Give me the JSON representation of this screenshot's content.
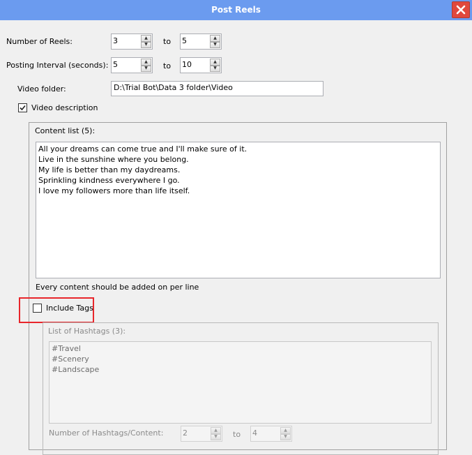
{
  "window": {
    "title": "Post Reels"
  },
  "reels": {
    "label": "Number of Reels:",
    "from": "3",
    "to_label": "to",
    "to": "5"
  },
  "interval": {
    "label": "Posting Interval (seconds):",
    "from": "5",
    "to_label": "to",
    "to": "10"
  },
  "video_folder": {
    "label": "Video folder:",
    "value": "D:\\Trial Bot\\Data 3 folder\\Video"
  },
  "video_description": {
    "label": "Video description",
    "checked": true
  },
  "content": {
    "title": "Content list (5):",
    "text": "All your dreams can come true and I'll make sure of it.\nLive in the sunshine where you belong.\nMy life is better than my daydreams.\nSprinkling kindness everywhere I go.\nI love my followers more than life itself.",
    "hint": "Every content should be added on per line"
  },
  "include_tags": {
    "label": "Include Tags",
    "checked": false,
    "highlight_color": "#e8262b"
  },
  "hashtags": {
    "title": "List of Hashtags (3):",
    "text": "#Travel\n#Scenery\n#Landscape",
    "count_label": "Number of Hashtags/Content:",
    "from": "2",
    "to_label": "to",
    "to": "4"
  },
  "colors": {
    "titlebar": "#6b9bef",
    "close": "#e0483d"
  }
}
